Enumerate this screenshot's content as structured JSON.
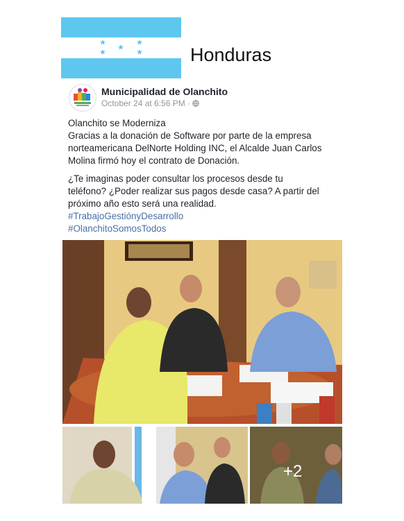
{
  "country": "Honduras",
  "post": {
    "page_name": "Municipalidad de Olanchito",
    "timestamp": "October 24 at 6:56 PM",
    "privacy_icon": "globe-icon",
    "lines1": [
      "Olanchito se Moderniza",
      "Gracias a la donación de Software por parte de la empresa",
      "norteamericana DelNorte Holding INC, el Alcalde Juan Carlos",
      "Molina firmó hoy el contrato de Donación."
    ],
    "lines2": [
      "¿Te imaginas poder consultar los procesos desde tu",
      "teléfono? ¿Poder realizar sus pagos desde casa? A partir del",
      "próximo año esto será una realidad."
    ],
    "hashtags": [
      "#TrabajoGestiónyDesarrollo",
      "#OlanchitoSomosTodos"
    ],
    "more_photos": "+2"
  },
  "colors": {
    "flag_blue": "#5ec7f0",
    "hashtag": "#4a6fa5"
  }
}
